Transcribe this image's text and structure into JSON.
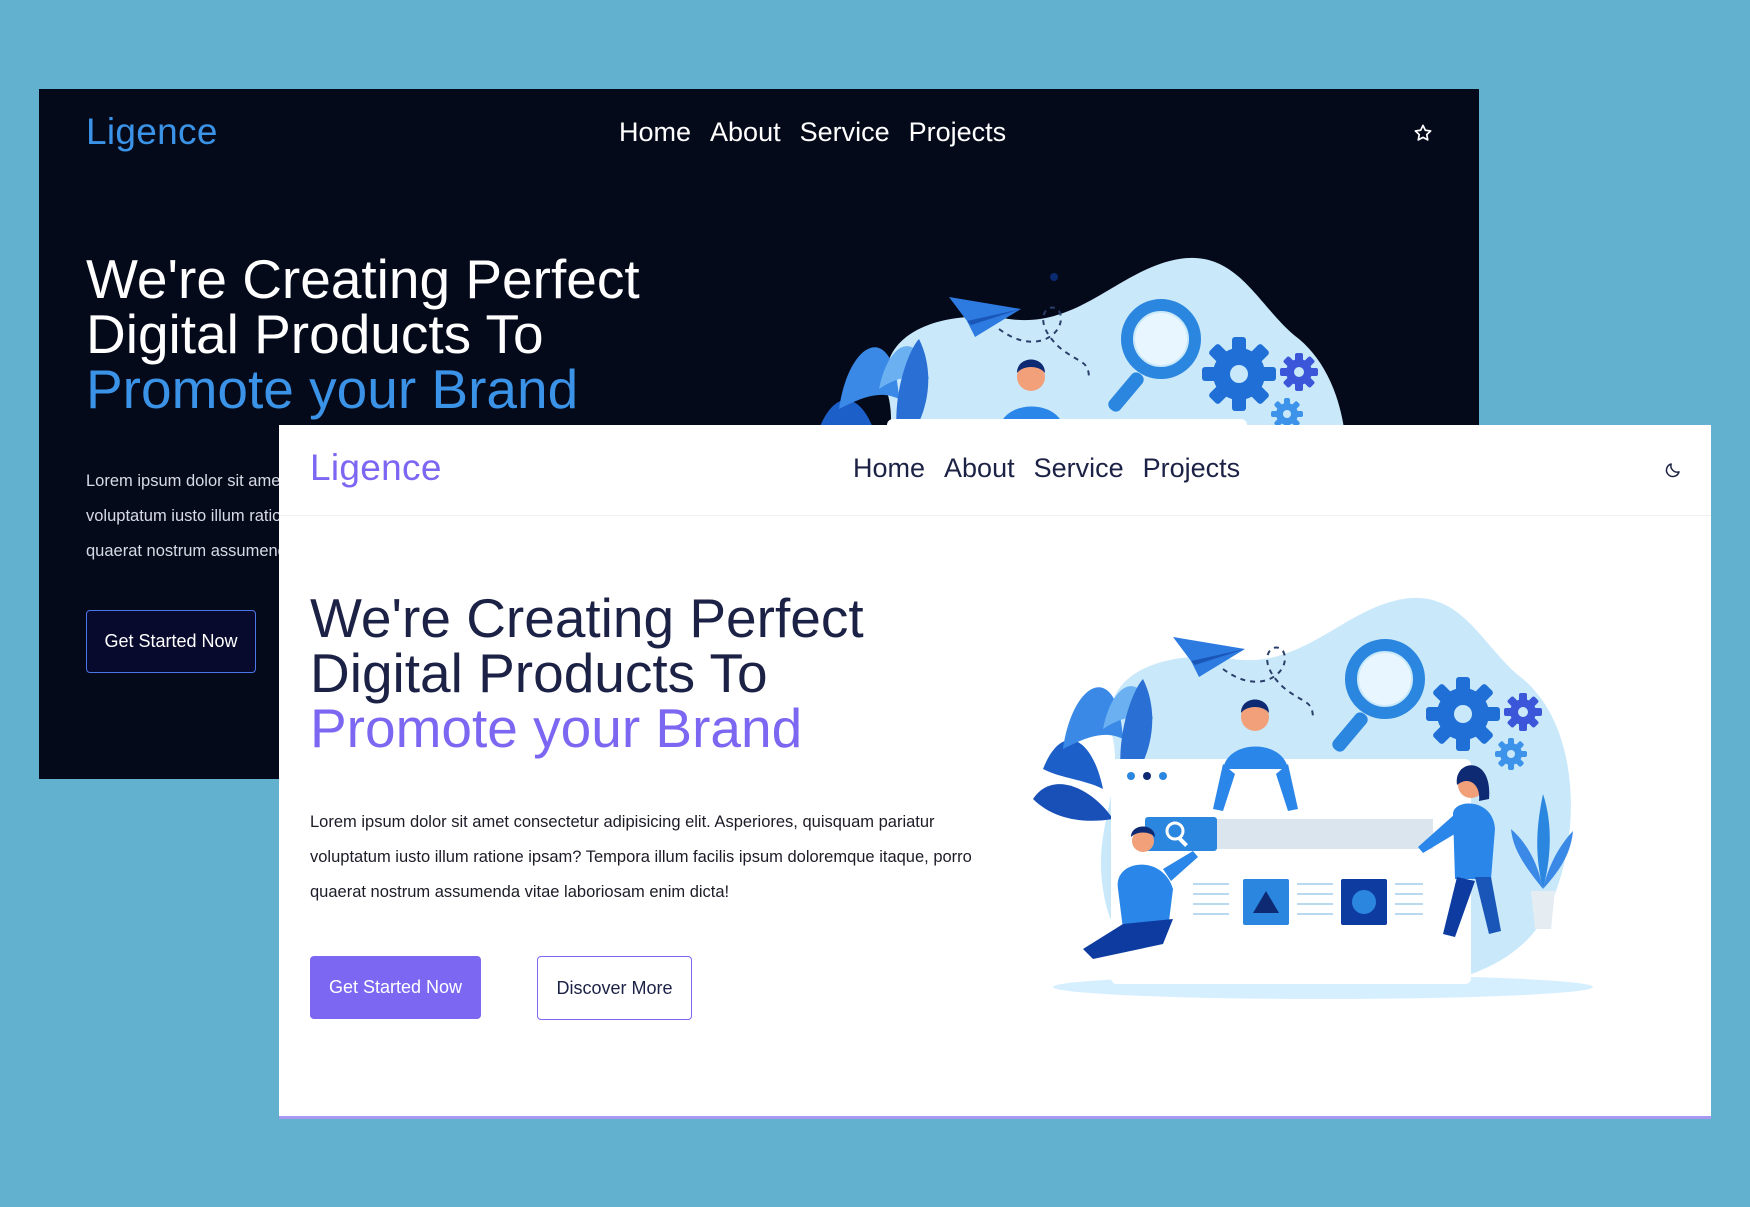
{
  "brand": {
    "name": "Ligence",
    "accent_dark": "#3b93e8",
    "accent_light": "#7c67f2",
    "bg_outer": "#62b2cf",
    "bg_dark": "#050a1a",
    "text_light_theme": "#1c2245"
  },
  "nav": {
    "items": [
      "Home",
      "About",
      "Service",
      "Projects"
    ],
    "dark_theme_icon": "star-icon",
    "light_theme_icon": "moon-icon"
  },
  "hero": {
    "title_line1": "We're Creating Perfect",
    "title_line2": "Digital Products To",
    "title_highlight": "Promote your Brand",
    "description": "Lorem ipsum dolor sit amet consectetur adipisicing elit. Asperiores, quisquam pariatur voluptatum iusto illum ratione ipsam? Tempora illum facilis ipsum doloremque itaque, porro quaerat nostrum assumenda vitae laboriosam enim dicta!",
    "primary_button": "Get Started Now",
    "secondary_button": "Discover More",
    "illustration": "team-building-website-illustration"
  }
}
